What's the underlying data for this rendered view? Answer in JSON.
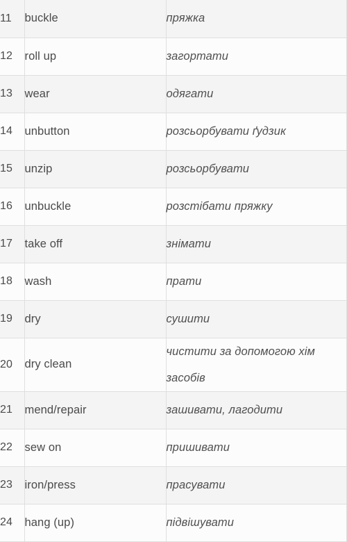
{
  "table": {
    "columns": [
      "number",
      "english_term",
      "ukrainian_translation"
    ],
    "rows": [
      {
        "num": "11",
        "term": "buckle",
        "translation": "пряжка"
      },
      {
        "num": "12",
        "term": "roll up",
        "translation": "загортати"
      },
      {
        "num": "13",
        "term": "wear",
        "translation": "одягати"
      },
      {
        "num": "14",
        "term": "unbutton",
        "translation": "розсьорбувати ґудзик"
      },
      {
        "num": "15",
        "term": "unzip",
        "translation": "розсьорбувати"
      },
      {
        "num": "16",
        "term": "unbuckle",
        "translation": "розстібати пряжку"
      },
      {
        "num": "17",
        "term": "take off",
        "translation": "знімати"
      },
      {
        "num": "18",
        "term": "wash",
        "translation": "прати"
      },
      {
        "num": "19",
        "term": "dry",
        "translation": "сушити"
      },
      {
        "num": "20",
        "term": "dry clean",
        "translation": "чистити за допомогою хім",
        "translation_line2": "засобів"
      },
      {
        "num": "21",
        "term": "mend/repair",
        "translation": "зашивати, лагодити"
      },
      {
        "num": "22",
        "term": "sew on",
        "translation": "пришивати"
      },
      {
        "num": "23",
        "term": "iron/press",
        "translation": "прасувати"
      },
      {
        "num": "24",
        "term": "hang (up)",
        "translation": "підвішувати"
      }
    ]
  },
  "colors": {
    "row_odd_background": "#f4f4f4",
    "row_even_background": "#fcfcfc",
    "border": "#dfdfdf",
    "text": "#4a4a4a"
  }
}
